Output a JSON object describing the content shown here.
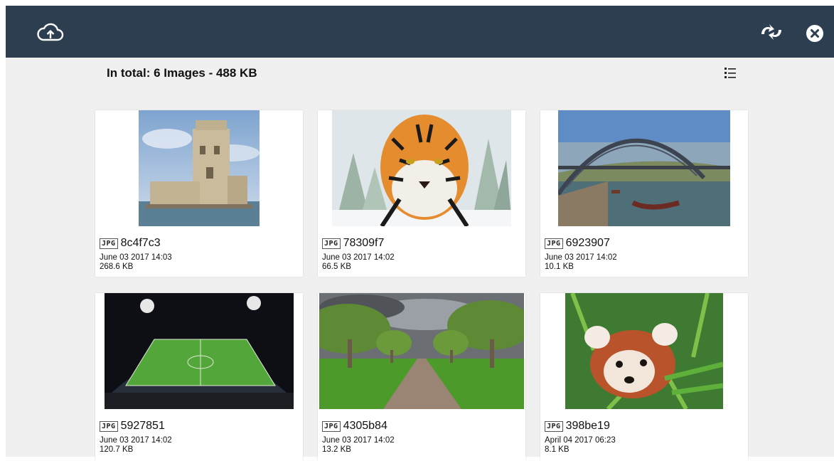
{
  "toolbar": {
    "upload_icon": "cloud-upload-icon",
    "sync_icon": "sync-icon",
    "close_icon": "close-icon"
  },
  "summary": "In total: 6 Images - 488 KB",
  "view_toggle_icon": "list-view-icon",
  "files": [
    {
      "type": "JPG",
      "name": "8c4f7c3",
      "date": "June 03 2017 14:03",
      "size": "268.6 KB"
    },
    {
      "type": "JPG",
      "name": "78309f7",
      "date": "June 03 2017 14:02",
      "size": "66.5 KB"
    },
    {
      "type": "JPG",
      "name": "6923907",
      "date": "June 03 2017 14:02",
      "size": "10.1 KB"
    },
    {
      "type": "JPG",
      "name": "5927851",
      "date": "June 03 2017 14:02",
      "size": "120.7 KB"
    },
    {
      "type": "JPG",
      "name": "4305b84",
      "date": "June 03 2017 14:02",
      "size": "13.2 KB"
    },
    {
      "type": "JPG",
      "name": "398be19",
      "date": "April 04 2017 06:23",
      "size": "8.1 KB"
    }
  ],
  "colors": {
    "topbar": "#2e3e51",
    "background": "#f0f0f0",
    "card": "#ffffff"
  }
}
